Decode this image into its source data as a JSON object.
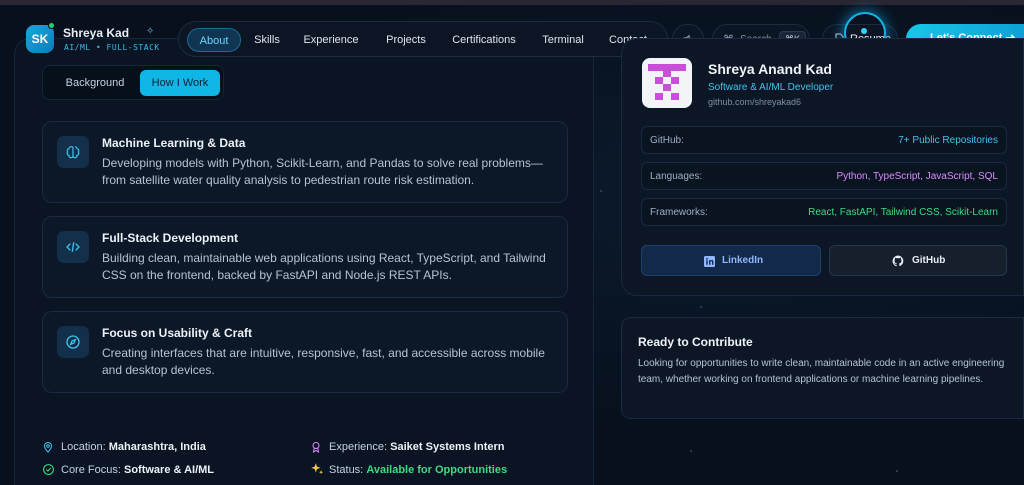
{
  "brand": {
    "initials": "SK",
    "name": "Shreya Kad",
    "tagline": "AI/ML • FULL-STACK"
  },
  "nav": {
    "items": [
      "About",
      "Skills",
      "Experience",
      "Projects",
      "Certifications",
      "Terminal",
      "Contact"
    ],
    "active": "About"
  },
  "search": {
    "label": "Search",
    "shortcut": "⌘K"
  },
  "resume": {
    "label": "Resume"
  },
  "connect": {
    "label": "Let's Connect"
  },
  "toggle": {
    "background": "Background",
    "how_i_work": "How I Work",
    "selected": "How I Work"
  },
  "cards": [
    {
      "title": "Machine Learning & Data",
      "desc": "Developing models with Python, Scikit-Learn, and Pandas to solve real problems—from satellite water quality analysis to pedestrian route risk estimation.",
      "icon": "brain-icon"
    },
    {
      "title": "Full-Stack Development",
      "desc": "Building clean, maintainable web applications using React, TypeScript, and Tailwind CSS on the frontend, backed by FastAPI and Node.js REST APIs.",
      "icon": "code-icon"
    },
    {
      "title": "Focus on Usability & Craft",
      "desc": "Creating interfaces that are intuitive, responsive, fast, and accessible across mobile and desktop devices.",
      "icon": "compass-icon"
    }
  ],
  "info": {
    "location_label": "Location:",
    "location_value": "Maharashtra, India",
    "experience_label": "Experience:",
    "experience_value": "Saiket Systems Intern",
    "focus_label": "Core Focus:",
    "focus_value": "Software & AI/ML",
    "status_label": "Status:",
    "status_value": "Available for Opportunities"
  },
  "profile": {
    "name": "Shreya Anand Kad",
    "role": "Software & AI/ML Developer",
    "link": "github.com/shreyakad6",
    "rows": [
      {
        "key": "GitHub:",
        "value": "7+ Public Repositories",
        "color": "#3fc3ee"
      },
      {
        "key": "Languages:",
        "value": "Python, TypeScript, JavaScript, SQL",
        "color": "#d98cff"
      },
      {
        "key": "Frameworks:",
        "value": "React, FastAPI, Tailwind CSS, Scikit-Learn",
        "color": "#3ddc84"
      }
    ],
    "linkedin": "LinkedIn",
    "github": "GitHub"
  },
  "contribute": {
    "title": "Ready to Contribute",
    "text": "Looking for opportunities to write clean, maintainable code in an active engineering team, whether working on frontend applications or machine learning pipelines."
  },
  "colors": {
    "accent": "#10b6e6",
    "status_green": "#3ddc84",
    "languages_purple": "#d98cff",
    "logo_magenta": "#c84fd8"
  }
}
